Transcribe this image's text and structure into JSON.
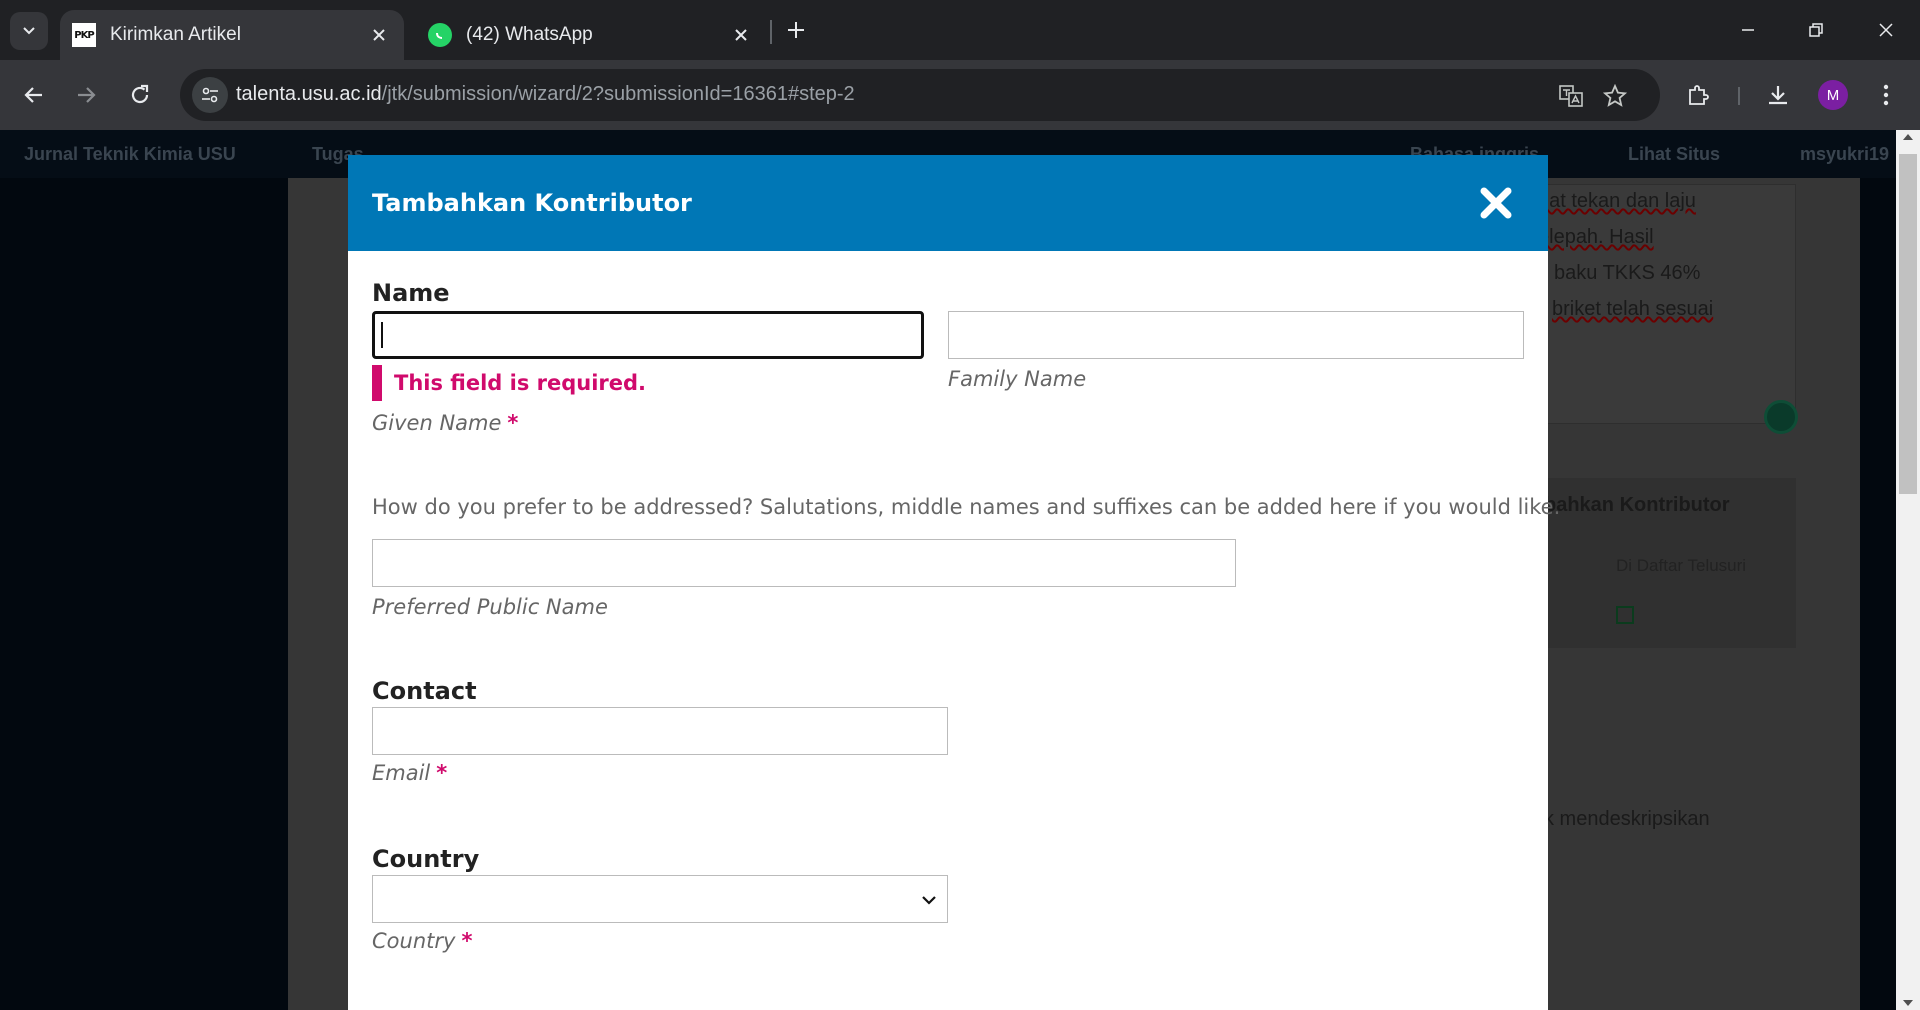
{
  "browser": {
    "tabs": [
      {
        "label": "Kirimkan Artikel",
        "favicon": "PKP",
        "active": true
      },
      {
        "label": "(42) WhatsApp",
        "favicon": "whatsapp-icon",
        "active": false
      }
    ],
    "url_host": "talenta.usu.ac.id",
    "url_path": "/jtk/submission/wizard/2?submissionId=16361#step-2",
    "profile_initial": "M"
  },
  "site": {
    "title": "Jurnal Teknik Kimia USU",
    "tasks": "Tugas",
    "language": "Bahasa inggris",
    "view_site": "Lihat Situs",
    "user": "msyukri19"
  },
  "background": {
    "lines": [
      "uat tekan dan laju",
      "elepah. Hasil",
      "baku TKKS 46%",
      "briket telah sesuai"
    ],
    "heading": "bahkan Kontributor",
    "column": "Di Daftar Telusuri",
    "description": "k mendeskripsikan"
  },
  "modal": {
    "title": "Tambahkan Kontributor",
    "name_section": "Name",
    "error": "This field is required.",
    "given_name_label": "Given Name",
    "family_name_label": "Family Name",
    "preferred_help": "How do you prefer to be addressed? Salutations, middle names and suffixes can be added here if you would like.",
    "preferred_label": "Preferred Public Name",
    "contact_section": "Contact",
    "email_label": "Email",
    "country_section": "Country",
    "country_label": "Country",
    "required_mark": "*",
    "given_name_value": "",
    "family_name_value": "",
    "preferred_value": "",
    "email_value": "",
    "country_value": ""
  },
  "colors": {
    "modal_header": "#0077b6",
    "error": "#d00a6c",
    "avatar": "#7b1fa2"
  }
}
